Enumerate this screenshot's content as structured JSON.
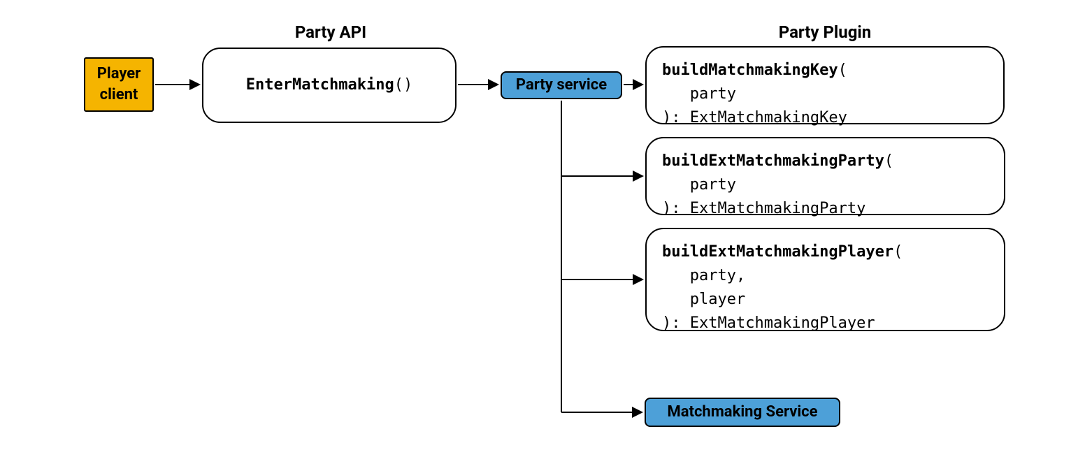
{
  "labels": {
    "party_api": "Party API",
    "party_plugin": "Party Plugin"
  },
  "nodes": {
    "player_client": "Player\nclient",
    "enter_matchmaking_name": "EnterMatchmaking",
    "enter_matchmaking_parens": "()",
    "party_service": "Party service",
    "matchmaking_service": "Matchmaking Service",
    "plugin1_name": "buildMatchmakingKey",
    "plugin1_sig": "(\n   party\n): ExtMatchmakingKey",
    "plugin2_name": "buildExtMatchmakingParty",
    "plugin2_sig": "(\n   party\n): ExtMatchmakingParty",
    "plugin3_name": "buildExtMatchmakingPlayer",
    "plugin3_sig": "(\n   party,\n   player\n): ExtMatchmakingPlayer"
  }
}
